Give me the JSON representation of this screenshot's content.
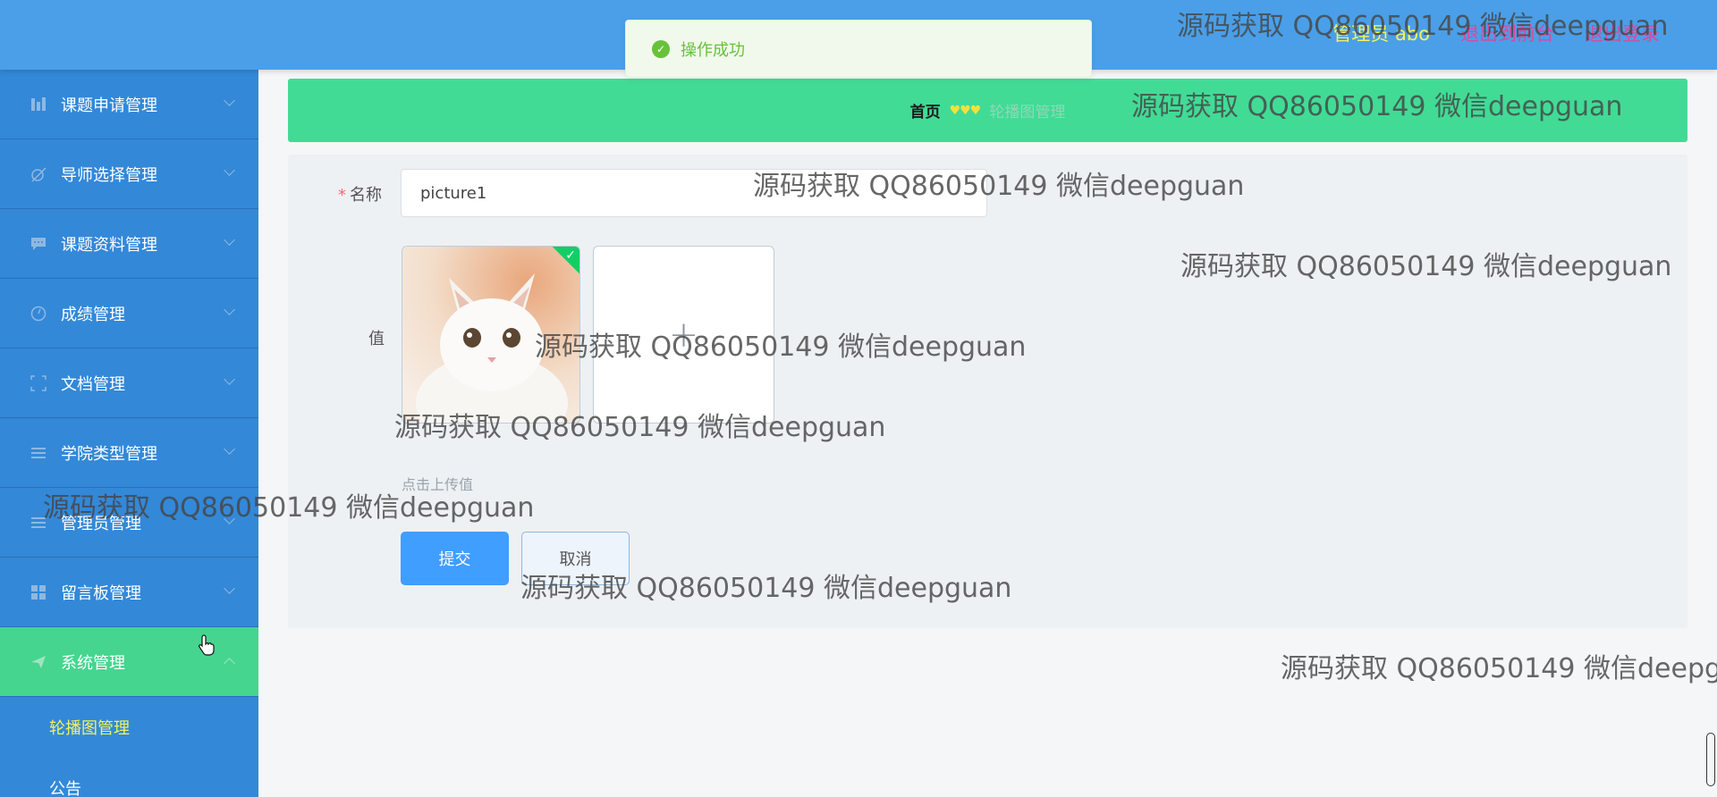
{
  "header": {
    "user_label": "管理员 abo",
    "frontend_link": "退出到前台",
    "logout_link": "退出登录"
  },
  "sidebar": {
    "items": [
      {
        "label": "课题申请管理",
        "icon": "chart-icon"
      },
      {
        "label": "导师选择管理",
        "icon": "wand-icon"
      },
      {
        "label": "课题资料管理",
        "icon": "chat-icon"
      },
      {
        "label": "成绩管理",
        "icon": "gauge-icon"
      },
      {
        "label": "文档管理",
        "icon": "fullscreen-icon"
      },
      {
        "label": "学院类型管理",
        "icon": "list-icon"
      },
      {
        "label": "管理员管理",
        "icon": "list-icon"
      },
      {
        "label": "留言板管理",
        "icon": "grid-icon"
      },
      {
        "label": "系统管理",
        "icon": "send-icon"
      }
    ],
    "subitems": [
      {
        "label": "轮播图管理"
      },
      {
        "label": "公告"
      }
    ]
  },
  "breadcrumb": {
    "home": "首页",
    "separator": "♥♥♥",
    "current": "轮播图管理"
  },
  "form": {
    "name_label": "名称",
    "name_value": "picture1",
    "value_label": "值",
    "upload_tip": "点击上传值",
    "submit_label": "提交",
    "cancel_label": "取消"
  },
  "toast": {
    "message": "操作成功"
  },
  "watermark": {
    "text": "源码获取 QQ86050149 微信deepguan"
  },
  "colors": {
    "header": "#4a9fe8",
    "sidebar": "#3388d8",
    "active_menu": "#45d58f",
    "breadcrumb": "#41db96",
    "primary_button": "#409eff",
    "success": "#67c23a"
  }
}
